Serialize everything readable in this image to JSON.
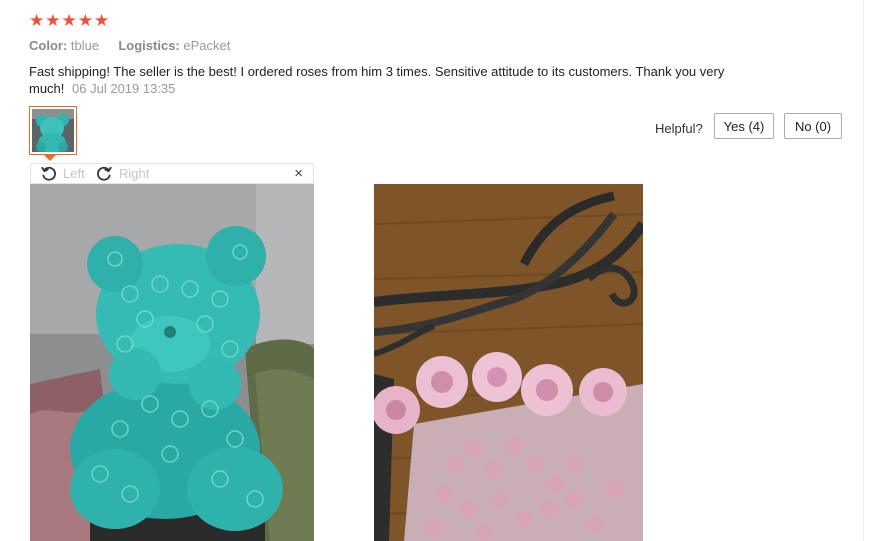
{
  "review": {
    "rating": 5,
    "star_glyph": "★",
    "color_label": "Color:",
    "color_value": "tblue",
    "logistics_label": "Logistics:",
    "logistics_value": "ePacket",
    "text": "Fast shipping! The seller is the best! I ordered roses from him 3 times. Sensitive attitude to its customers. Thank you very much!",
    "date": "06 Jul 2019 13:35",
    "star_color": "#f0503c"
  },
  "feedback": {
    "helpful_label": "Helpful?",
    "yes_label": "Yes (4)",
    "no_label": "No (0)"
  },
  "viewer": {
    "rotate_left_label": "Left",
    "rotate_right_label": "Right",
    "close_glyph": "×",
    "accent_color": "#e56c2b"
  }
}
